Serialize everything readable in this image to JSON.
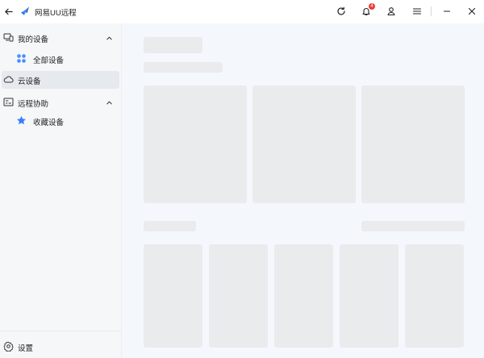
{
  "app": {
    "title": "网易UU远程"
  },
  "titlebar": {
    "notification_count": "4",
    "icons": [
      "back-arrow-icon",
      "app-logo-icon",
      "refresh-icon",
      "bell-icon",
      "user-icon",
      "menu-icon",
      "minimize-icon",
      "close-icon"
    ]
  },
  "sidebar": {
    "sections": [
      {
        "label": "我的设备",
        "icon": "devices-icon",
        "expanded": true
      },
      {
        "label": "全部设备",
        "icon": "grid-dots-icon"
      },
      {
        "label": "云设备",
        "icon": "cloud-icon",
        "selected": true
      },
      {
        "label": "远程协助",
        "icon": "remote-assist-icon",
        "expanded": true
      },
      {
        "label": "收藏设备",
        "icon": "star-icon"
      }
    ],
    "settings_label": "设置"
  },
  "colors": {
    "accent": "#3d7bff",
    "sidebar_bg": "#f5f7f9",
    "main_bg": "#f4f8fc",
    "skeleton": "#e9ebed",
    "badge": "#ee3b3b"
  }
}
